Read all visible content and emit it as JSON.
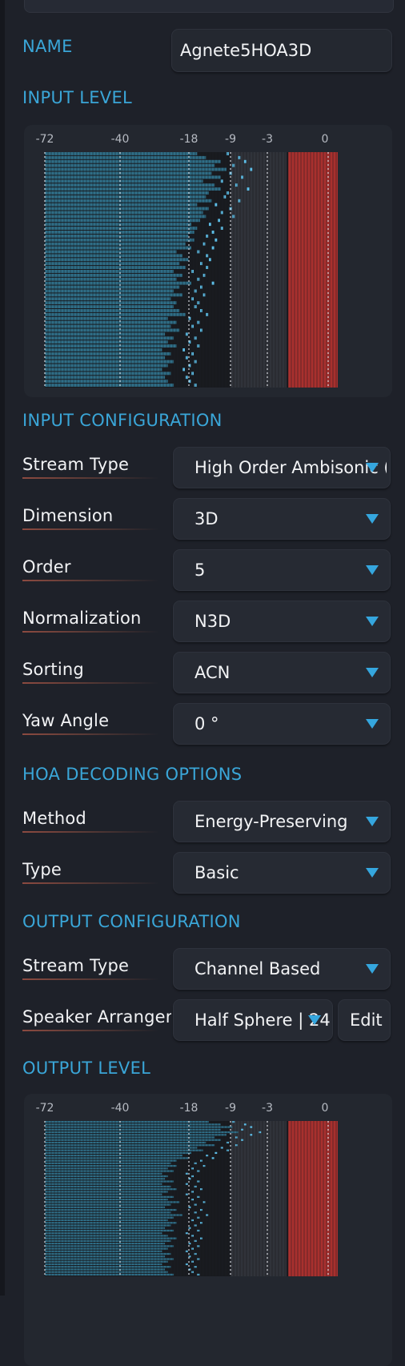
{
  "name": {
    "label": "NAME",
    "value": "Agnete5HOA3D"
  },
  "input_level": {
    "title": "INPUT LEVEL",
    "scale_labels": [
      "-72",
      "-40",
      "-18",
      "-9",
      "-3",
      "0"
    ],
    "bar_fraction": [
      0.52,
      0.55,
      0.6,
      0.58,
      0.62,
      0.57,
      0.6,
      0.54,
      0.58,
      0.6,
      0.56,
      0.55,
      0.57,
      0.52,
      0.56,
      0.54,
      0.55,
      0.53,
      0.5,
      0.52,
      0.51,
      0.49,
      0.51,
      0.48,
      0.5,
      0.45,
      0.47,
      0.49,
      0.46,
      0.48,
      0.44,
      0.47,
      0.45,
      0.5,
      0.46,
      0.44,
      0.47,
      0.43,
      0.45,
      0.44,
      0.46,
      0.48,
      0.42,
      0.45,
      0.43,
      0.46,
      0.41,
      0.44,
      0.42,
      0.45,
      0.4,
      0.43,
      0.41,
      0.44,
      0.42,
      0.4,
      0.43,
      0.41,
      0.42,
      0.44
    ],
    "peak_fraction": [
      0.62,
      0.66,
      0.68,
      0.64,
      0.7,
      0.63,
      0.67,
      0.6,
      0.65,
      0.69,
      0.62,
      0.61,
      0.66,
      0.58,
      0.63,
      0.6,
      0.64,
      0.59,
      0.56,
      0.6,
      0.57,
      0.55,
      0.58,
      0.54,
      0.57,
      0.52,
      0.55,
      0.56,
      0.53,
      0.55,
      0.5,
      0.54,
      0.52,
      0.57,
      0.53,
      0.51,
      0.54,
      0.5,
      0.52,
      0.51,
      0.53,
      0.55,
      0.49,
      0.52,
      0.5,
      0.53,
      0.48,
      0.51,
      0.49,
      0.52,
      0.47,
      0.5,
      0.48,
      0.51,
      0.49,
      0.47,
      0.5,
      0.48,
      0.49,
      0.51
    ]
  },
  "input_config": {
    "title": "INPUT CONFIGURATION",
    "rows": [
      {
        "label": "Stream Type",
        "value": "High Order Ambisonic ("
      },
      {
        "label": "Dimension",
        "value": "3D"
      },
      {
        "label": "Order",
        "value": "5"
      },
      {
        "label": "Normalization",
        "value": "N3D"
      },
      {
        "label": "Sorting",
        "value": "ACN"
      },
      {
        "label": "Yaw Angle",
        "value": "0 °"
      }
    ]
  },
  "hoa_decoding": {
    "title": "HOA DECODING OPTIONS",
    "rows": [
      {
        "label": "Method",
        "value": "Energy-Preserving"
      },
      {
        "label": "Type",
        "value": "Basic"
      }
    ]
  },
  "output_config": {
    "title": "OUTPUT CONFIGURATION",
    "stream_type": {
      "label": "Stream Type",
      "value": "Channel Based"
    },
    "speaker": {
      "label": "Speaker Arrangement",
      "value": "Half Sphere | 24.",
      "edit_label": "Edit"
    }
  },
  "output_level": {
    "title": "OUTPUT LEVEL",
    "scale_labels": [
      "-72",
      "-40",
      "-18",
      "-9",
      "-3",
      "0"
    ],
    "bar_fraction": [
      0.56,
      0.6,
      0.64,
      0.6,
      0.66,
      0.62,
      0.58,
      0.6,
      0.55,
      0.58,
      0.52,
      0.54,
      0.5,
      0.47,
      0.49,
      0.45,
      0.43,
      0.45,
      0.42,
      0.44,
      0.4,
      0.42,
      0.41,
      0.44,
      0.4,
      0.43,
      0.45,
      0.42,
      0.4,
      0.44,
      0.42,
      0.46,
      0.43,
      0.41,
      0.45,
      0.43,
      0.47,
      0.44,
      0.42,
      0.45,
      0.43,
      0.41,
      0.44,
      0.4,
      0.42,
      0.45,
      0.43,
      0.41,
      0.44,
      0.42,
      0.4,
      0.43,
      0.41,
      0.44,
      0.42,
      0.4,
      0.43,
      0.41,
      0.42,
      0.44
    ],
    "peak_fraction": [
      0.64,
      0.68,
      0.7,
      0.67,
      0.73,
      0.7,
      0.65,
      0.67,
      0.62,
      0.65,
      0.6,
      0.62,
      0.58,
      0.55,
      0.57,
      0.53,
      0.51,
      0.54,
      0.5,
      0.52,
      0.48,
      0.5,
      0.49,
      0.52,
      0.48,
      0.51,
      0.53,
      0.5,
      0.48,
      0.52,
      0.5,
      0.54,
      0.51,
      0.49,
      0.53,
      0.51,
      0.55,
      0.52,
      0.5,
      0.53,
      0.51,
      0.49,
      0.52,
      0.48,
      0.5,
      0.53,
      0.51,
      0.49,
      0.52,
      0.5,
      0.48,
      0.51,
      0.49,
      0.52,
      0.5,
      0.48,
      0.51,
      0.49,
      0.5,
      0.52
    ]
  },
  "colors": {
    "accent": "#3aa6d8",
    "meter_fill": "#2f6d86",
    "meter_peak": "#5dbde6",
    "meter_red": "#a8302e"
  }
}
